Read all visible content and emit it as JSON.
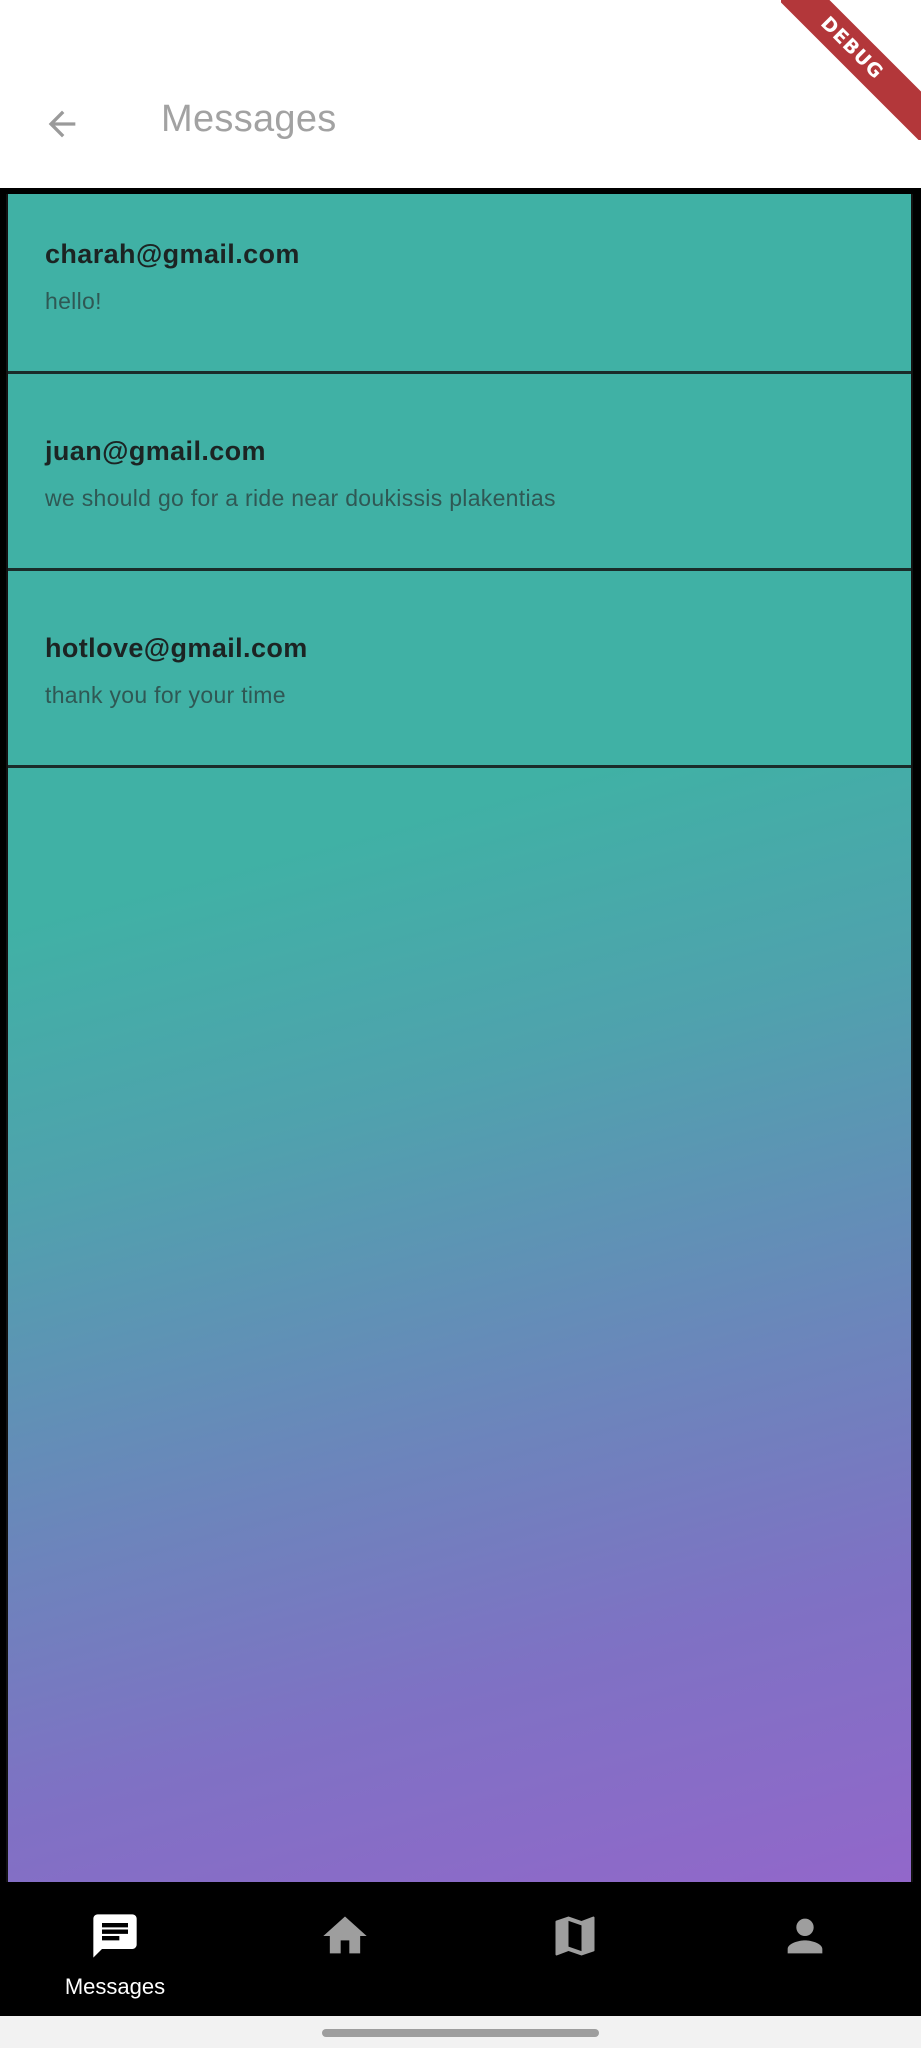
{
  "app_bar": {
    "title": "Messages",
    "back_icon": "arrow-left-icon"
  },
  "debug_banner": {
    "label": "DEBUG",
    "color": "#b3373a"
  },
  "messages": [
    {
      "sender": "charah@gmail.com",
      "text": "hello!"
    },
    {
      "sender": "juan@gmail.com",
      "text": "we should go for a ride near doukissis plakentias"
    },
    {
      "sender": "hotlove@gmail.com",
      "text": "thank you for your time"
    }
  ],
  "bottom_nav": {
    "items": [
      {
        "label": "Messages",
        "icon": "message-icon",
        "active": true
      },
      {
        "label": "",
        "icon": "home-icon",
        "active": false
      },
      {
        "label": "",
        "icon": "map-icon",
        "active": false
      },
      {
        "label": "",
        "icon": "person-icon",
        "active": false
      }
    ],
    "active_color": "#ffffff",
    "inactive_color": "#9e9e9e"
  },
  "colors": {
    "teal": "#40b1a5",
    "purple": "#9267ca",
    "app_bar_bg": "#ffffff"
  }
}
